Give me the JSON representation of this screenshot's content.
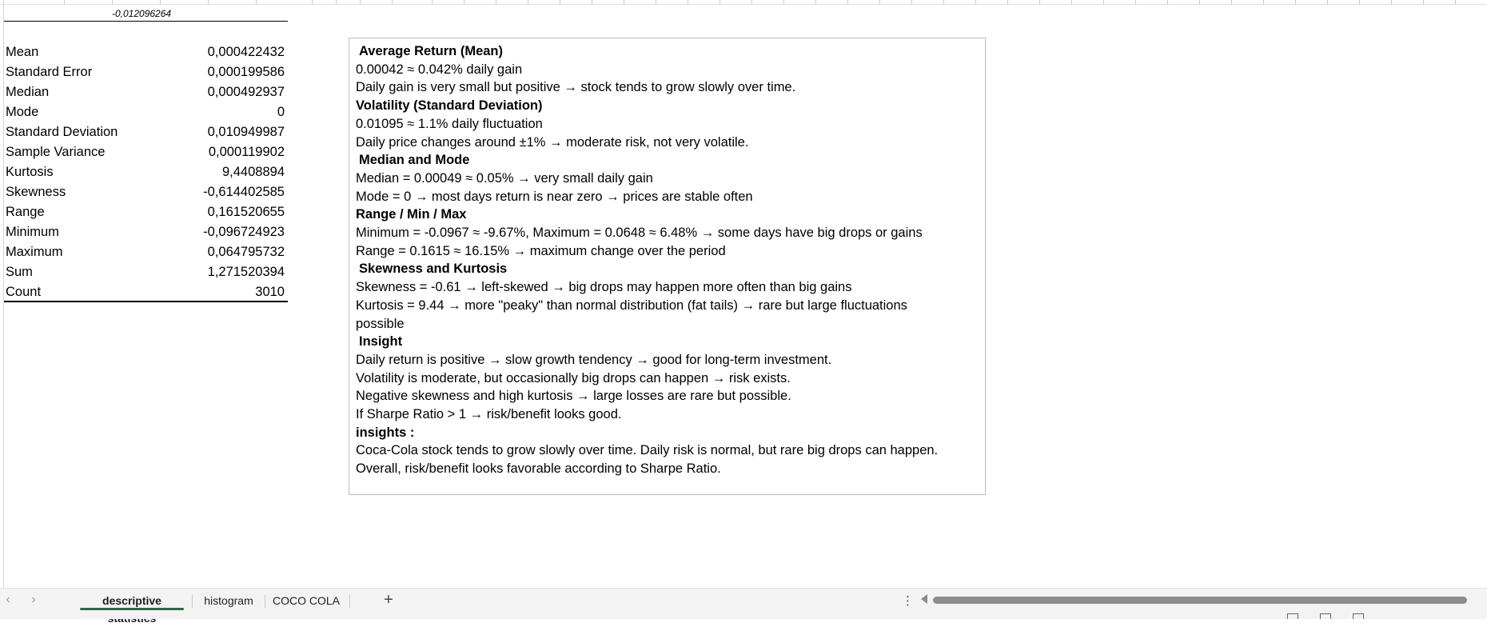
{
  "previous_cell_value": "-0,012096264",
  "stats": [
    {
      "label": "Mean",
      "value": "0,000422432"
    },
    {
      "label": "Standard Error",
      "value": "0,000199586"
    },
    {
      "label": "Median",
      "value": "0,000492937"
    },
    {
      "label": "Mode",
      "value": "0"
    },
    {
      "label": "Standard Deviation",
      "value": "0,010949987"
    },
    {
      "label": "Sample Variance",
      "value": "0,000119902"
    },
    {
      "label": "Kurtosis",
      "value": "9,4408894"
    },
    {
      "label": "Skewness",
      "value": "-0,614402585"
    },
    {
      "label": "Range",
      "value": "0,161520655"
    },
    {
      "label": "Minimum",
      "value": "-0,096724923"
    },
    {
      "label": "Maximum",
      "value": "0,064795732"
    },
    {
      "label": "Sum",
      "value": "1,271520394"
    },
    {
      "label": "Count",
      "value": "3010"
    }
  ],
  "textbox": {
    "lines": [
      {
        "text": "Average Return (Mean)",
        "bold": true,
        "indent": true
      },
      {
        "text": "0.00042 ≈ 0.042% daily gain",
        "bold": false,
        "indent": false
      },
      {
        "text": "Daily gain is very small but positive → stock tends to grow slowly over time.",
        "bold": false,
        "indent": false
      },
      {
        "text": "Volatility (Standard Deviation)",
        "bold": true,
        "indent": false
      },
      {
        "text": "0.01095 ≈ 1.1% daily fluctuation",
        "bold": false,
        "indent": false
      },
      {
        "text": "Daily price changes around ±1% → moderate risk, not very volatile.",
        "bold": false,
        "indent": false
      },
      {
        "text": "Median and Mode",
        "bold": true,
        "indent": true
      },
      {
        "text": "Median = 0.00049 ≈ 0.05% → very small daily gain",
        "bold": false,
        "indent": false
      },
      {
        "text": "Mode = 0 → most days return is near zero → prices are stable often",
        "bold": false,
        "indent": false
      },
      {
        "text": "Range / Min / Max",
        "bold": true,
        "indent": false
      },
      {
        "text": "Minimum = -0.0967 ≈ -9.67%, Maximum = 0.0648 ≈ 6.48% → some days have big drops or gains",
        "bold": false,
        "indent": false
      },
      {
        "text": "Range = 0.1615 ≈ 16.15% → maximum change over the period",
        "bold": false,
        "indent": false
      },
      {
        "text": "Skewness and Kurtosis",
        "bold": true,
        "indent": true
      },
      {
        "text": "Skewness = -0.61 → left-skewed → big drops may happen more often than big gains",
        "bold": false,
        "indent": false
      },
      {
        "text": "Kurtosis = 9.44 → more \"peaky\" than normal distribution (fat tails) → rare but large fluctuations",
        "bold": false,
        "indent": false
      },
      {
        "text": "possible",
        "bold": false,
        "indent": false
      },
      {
        "text": "Insight",
        "bold": true,
        "indent": true
      },
      {
        "text": "Daily return is positive → slow growth tendency → good for long-term investment.",
        "bold": false,
        "indent": false
      },
      {
        "text": "Volatility is moderate, but occasionally big drops can happen → risk exists.",
        "bold": false,
        "indent": false
      },
      {
        "text": "Negative skewness and high kurtosis → large losses are rare but possible.",
        "bold": false,
        "indent": false
      },
      {
        "text": "If Sharpe Ratio > 1 → risk/benefit looks good.",
        "bold": false,
        "indent": false
      },
      {
        "text": "insights :",
        "bold": true,
        "indent": false
      },
      {
        "text": "Coca-Cola stock tends to grow slowly over time. Daily risk is normal, but rare big drops can happen.",
        "bold": false,
        "indent": false
      },
      {
        "text": "Overall, risk/benefit looks favorable according to Sharpe Ratio.",
        "bold": false,
        "indent": false
      }
    ]
  },
  "sheet_tabs": [
    {
      "label": "descriptive statistics",
      "active": true
    },
    {
      "label": "histogram",
      "active": false
    },
    {
      "label": "COCO COLA",
      "active": false
    }
  ],
  "nav": {
    "prev": "‹",
    "next": "›",
    "add": "+",
    "more": "⋮"
  },
  "colors": {
    "active_tab_underline": "#1e7145",
    "scroll_thumb": "#8c8c8c"
  }
}
